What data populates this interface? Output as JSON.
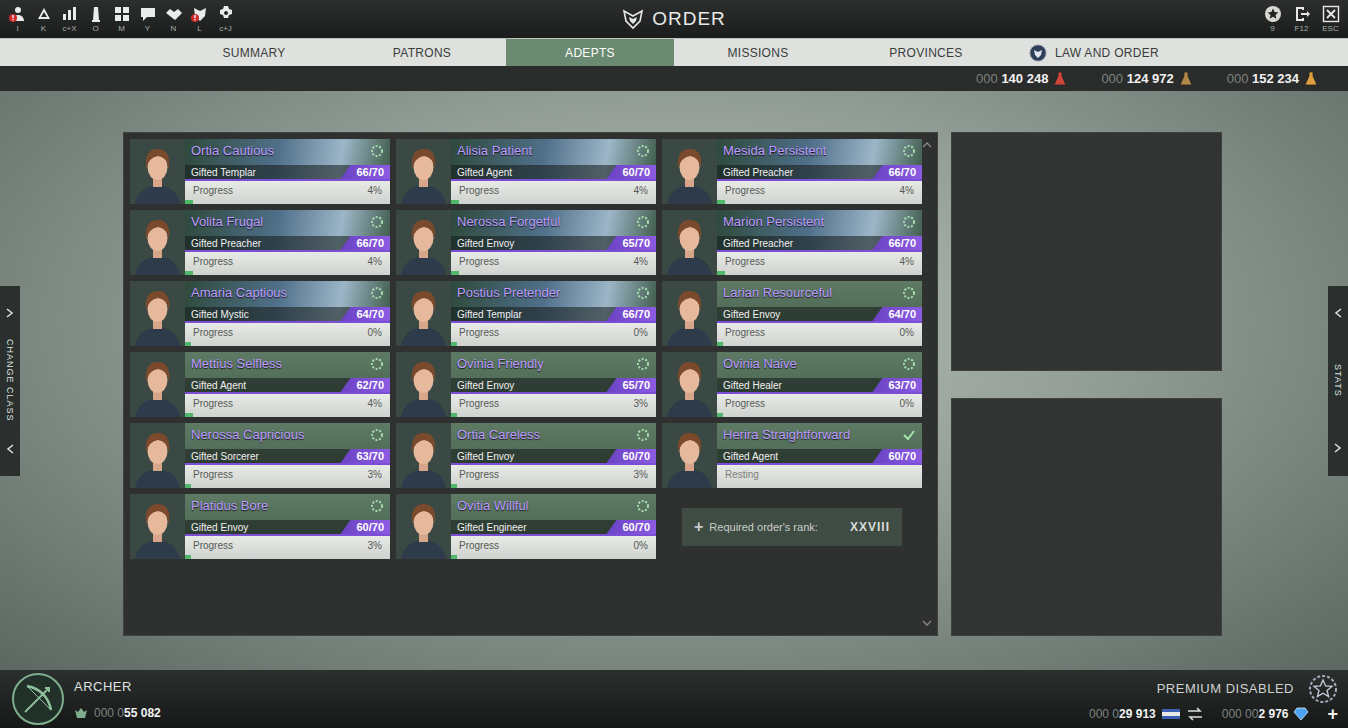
{
  "window": {
    "title": "ORDER"
  },
  "toolbar": {
    "left": [
      {
        "hotkey": "I",
        "alert": true
      },
      {
        "hotkey": "K",
        "alert": false
      },
      {
        "hotkey": "c+X",
        "alert": false
      },
      {
        "hotkey": "O",
        "alert": false
      },
      {
        "hotkey": "M",
        "alert": false
      },
      {
        "hotkey": "Y",
        "alert": false
      },
      {
        "hotkey": "N",
        "alert": false
      },
      {
        "hotkey": "L",
        "alert": true
      },
      {
        "hotkey": "c+J",
        "alert": false
      }
    ],
    "right": [
      {
        "hotkey": "9"
      },
      {
        "hotkey": "F12"
      },
      {
        "hotkey": "ESC"
      }
    ]
  },
  "tabs": [
    {
      "label": "SUMMARY",
      "selected": false,
      "has_icon": false
    },
    {
      "label": "PATRONS",
      "selected": false,
      "has_icon": false
    },
    {
      "label": "ADEPTS",
      "selected": true,
      "has_icon": false
    },
    {
      "label": "MISSIONS",
      "selected": false,
      "has_icon": false
    },
    {
      "label": "PROVINCES",
      "selected": false,
      "has_icon": false
    },
    {
      "label": "LAW AND ORDER",
      "selected": false,
      "has_icon": true
    }
  ],
  "currencies": [
    {
      "prefix": "000 ",
      "value": "140 248"
    },
    {
      "prefix": "000 ",
      "value": "124 972"
    },
    {
      "prefix": "000 ",
      "value": "152 234"
    }
  ],
  "adepts": [
    {
      "name": "Ortia Cautious",
      "class": "Gifted Templar",
      "rank": "66/70",
      "banner": "landscape",
      "status": "busy",
      "progress": {
        "label": "Progress",
        "percent": "4%",
        "level": 0.04
      }
    },
    {
      "name": "Alisia Patient",
      "class": "Gifted Agent",
      "rank": "60/70",
      "banner": "landscape",
      "status": "busy",
      "progress": {
        "label": "Progress",
        "percent": "4%",
        "level": 0.04
      }
    },
    {
      "name": "Mesida Persistent",
      "class": "Gifted Preacher",
      "rank": "66/70",
      "banner": "landscape",
      "status": "busy",
      "progress": {
        "label": "Progress",
        "percent": "4%",
        "level": 0.04
      }
    },
    {
      "name": "Volita Frugal",
      "class": "Gifted Preacher",
      "rank": "66/70",
      "banner": "landscape",
      "status": "busy",
      "progress": {
        "label": "Progress",
        "percent": "4%",
        "level": 0.04
      }
    },
    {
      "name": "Nerossa Forgetful",
      "class": "Gifted Envoy",
      "rank": "65/70",
      "banner": "landscape",
      "status": "busy",
      "progress": {
        "label": "Progress",
        "percent": "4%",
        "level": 0.04
      }
    },
    {
      "name": "Marion Persistent",
      "class": "Gifted Preacher",
      "rank": "66/70",
      "banner": "landscape",
      "status": "busy",
      "progress": {
        "label": "Progress",
        "percent": "4%",
        "level": 0.04
      }
    },
    {
      "name": "Amaria Captious",
      "class": "Gifted Mystic",
      "rank": "64/70",
      "banner": "landscape",
      "status": "busy",
      "progress": {
        "label": "Progress",
        "percent": "0%",
        "level": 0.0
      }
    },
    {
      "name": "Postius Pretender",
      "class": "Gifted Templar",
      "rank": "66/70",
      "banner": "landscape",
      "status": "busy",
      "progress": {
        "label": "Progress",
        "percent": "0%",
        "level": 0.0
      }
    },
    {
      "name": "Larian Resourceful",
      "class": "Gifted Envoy",
      "rank": "64/70",
      "banner": "plain",
      "status": "busy",
      "progress": {
        "label": "Progress",
        "percent": "0%",
        "level": 0.0
      }
    },
    {
      "name": "Mettius Selfless",
      "class": "Gifted Agent",
      "rank": "62/70",
      "banner": "plain",
      "status": "busy",
      "progress": {
        "label": "Progress",
        "percent": "4%",
        "level": 0.04
      }
    },
    {
      "name": "Ovinia Friendly",
      "class": "Gifted Envoy",
      "rank": "65/70",
      "banner": "plain",
      "status": "busy",
      "progress": {
        "label": "Progress",
        "percent": "3%",
        "level": 0.03
      }
    },
    {
      "name": "Ovinia Naive",
      "class": "Gifted Healer",
      "rank": "63/70",
      "banner": "plain",
      "status": "busy",
      "progress": {
        "label": "Progress",
        "percent": "0%",
        "level": 0.0
      }
    },
    {
      "name": "Nerossa Capricious",
      "class": "Gifted Sorcerer",
      "rank": "63/70",
      "banner": "plain",
      "status": "busy",
      "progress": {
        "label": "Progress",
        "percent": "3%",
        "level": 0.03
      }
    },
    {
      "name": "Ortia Careless",
      "class": "Gifted Envoy",
      "rank": "60/70",
      "banner": "plain",
      "status": "busy",
      "progress": {
        "label": "Progress",
        "percent": "3%",
        "level": 0.03
      }
    },
    {
      "name": "Herira Straightforward",
      "class": "Gifted Agent",
      "rank": "60/70",
      "banner": "plain",
      "status": "resting",
      "progress": {
        "label": "Resting"
      }
    },
    {
      "name": "Platidus Bore",
      "class": "Gifted Envoy",
      "rank": "60/70",
      "banner": "plain",
      "status": "busy",
      "progress": {
        "label": "Progress",
        "percent": "3%",
        "level": 0.03
      }
    },
    {
      "name": "Ovitia Willful",
      "class": "Gifted Engineer",
      "rank": "60/70",
      "banner": "plain",
      "status": "busy",
      "progress": {
        "label": "Progress",
        "percent": "0%",
        "level": 0.0
      }
    }
  ],
  "rank_requirement": {
    "icon": "+",
    "label": "Required order's rank:",
    "rank": "XXVIII"
  },
  "side_tabs": {
    "left": "CHANGE CLASS",
    "right": "STATS"
  },
  "footer": {
    "class_name": "ARCHER",
    "class_currency": {
      "prefix": "000 0",
      "value": "55 082"
    },
    "premium": "PREMIUM DISABLED",
    "currencies": [
      {
        "prefix": "000 0",
        "value": "29 913"
      },
      {
        "prefix": "000 00",
        "value": "2 976"
      }
    ],
    "add": "+"
  }
}
